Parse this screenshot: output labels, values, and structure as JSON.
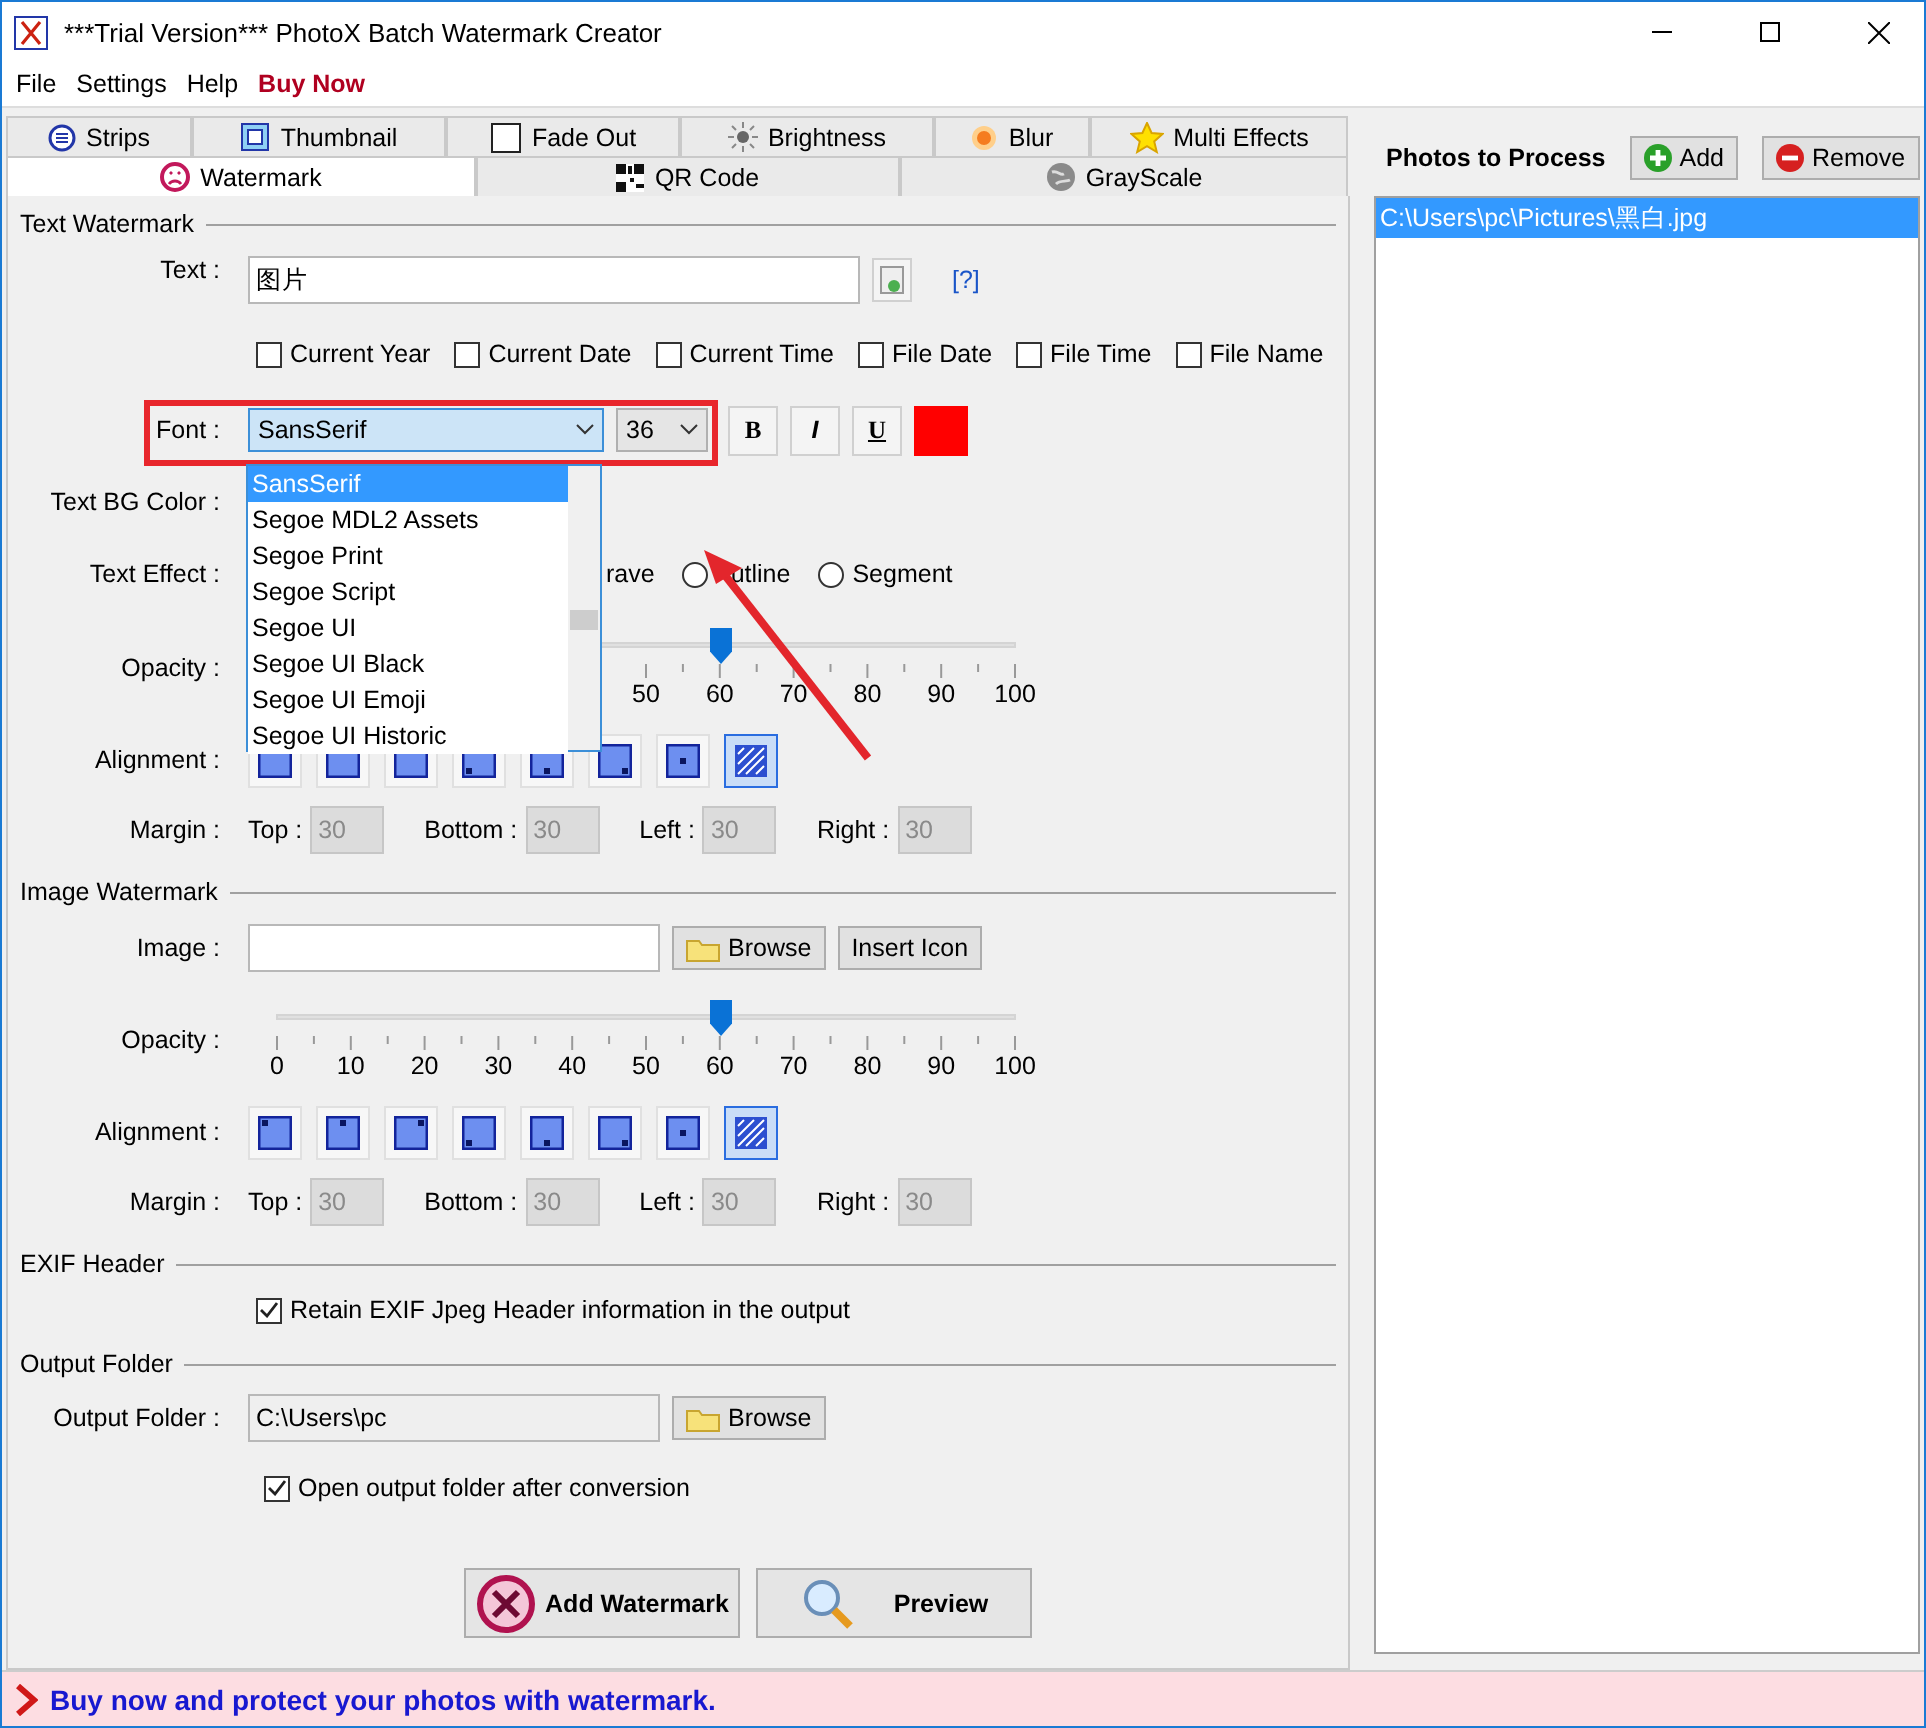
{
  "window": {
    "title": "***Trial Version*** PhotoX Batch Watermark Creator"
  },
  "menu": [
    {
      "label": "File",
      "kind": "plain"
    },
    {
      "label": "Settings",
      "kind": "plain"
    },
    {
      "label": "Help",
      "kind": "plain"
    },
    {
      "label": "Buy Now",
      "kind": "promo"
    }
  ],
  "tabs_top": [
    {
      "label": "Strips",
      "selected": false
    },
    {
      "label": "Thumbnail",
      "selected": false
    },
    {
      "label": "Fade Out",
      "selected": false
    },
    {
      "label": "Brightness",
      "selected": false
    },
    {
      "label": "Blur",
      "selected": false
    },
    {
      "label": "Multi Effects",
      "selected": false
    }
  ],
  "tabs_bottom": [
    {
      "label": "Watermark",
      "selected": true
    },
    {
      "label": "QR Code",
      "selected": false
    },
    {
      "label": "GrayScale",
      "selected": false
    }
  ],
  "text_watermark": {
    "heading": "Text Watermark",
    "text_label": "Text :",
    "text_value": "图片",
    "help": "[?]",
    "tokens": [
      {
        "label": "Current Year",
        "checked": false
      },
      {
        "label": "Current Date",
        "checked": false
      },
      {
        "label": "Current Time",
        "checked": false
      },
      {
        "label": "File Date",
        "checked": false
      },
      {
        "label": "File Time",
        "checked": false
      },
      {
        "label": "File Name",
        "checked": false
      }
    ],
    "font_label": "Font :",
    "font": "SansSerif",
    "size": "36",
    "bold": "B",
    "italic": "I",
    "underline": "U",
    "color": "#ff0000",
    "bg_label": "Text BG Color :",
    "effect_label": "Text Effect  :",
    "effects": [
      {
        "label": "rave",
        "kind": "cut",
        "selected": false
      },
      {
        "label": "utline",
        "kind": "radio",
        "selected": false
      },
      {
        "label": "Segment",
        "kind": "radio",
        "selected": false
      }
    ],
    "opacity_label": "Opacity :",
    "opacity": {
      "level": 0.6,
      "ticks": [
        "50",
        "60",
        "70",
        "80",
        "90",
        "100"
      ]
    },
    "alignment_label": "Alignment :",
    "alignment": [
      {
        "selected": false
      },
      {
        "selected": false
      },
      {
        "selected": false
      },
      {
        "selected": false
      },
      {
        "selected": false
      },
      {
        "selected": false
      },
      {
        "selected": false
      },
      {
        "selected": true
      }
    ],
    "margin_label": "Margin :",
    "margins": [
      {
        "label": "Top :",
        "value": "30",
        "disabled": true
      },
      {
        "label": "Bottom :",
        "value": "30",
        "disabled": true
      },
      {
        "label": "Left :",
        "value": "30",
        "disabled": true
      },
      {
        "label": "Right :",
        "value": "30",
        "disabled": true
      }
    ]
  },
  "font_dropdown": [
    {
      "label": "SansSerif",
      "selected": true
    },
    {
      "label": "Segoe MDL2 Assets",
      "selected": false
    },
    {
      "label": "Segoe Print",
      "selected": false
    },
    {
      "label": "Segoe Script",
      "selected": false
    },
    {
      "label": "Segoe UI",
      "selected": false
    },
    {
      "label": "Segoe UI Black",
      "selected": false
    },
    {
      "label": "Segoe UI Emoji",
      "selected": false
    },
    {
      "label": "Segoe UI Historic",
      "selected": false
    }
  ],
  "image_watermark": {
    "heading": "Image Watermark",
    "image_label": "Image :",
    "browse": "Browse",
    "insert_icon": "Insert Icon",
    "opacity_label": "Opacity :",
    "opacity": {
      "level": 0.6,
      "ticks": [
        "0",
        "10",
        "20",
        "30",
        "40",
        "50",
        "60",
        "70",
        "80",
        "90",
        "100"
      ]
    },
    "alignment_label": "Alignment :",
    "alignment": [
      {
        "selected": false
      },
      {
        "selected": false
      },
      {
        "selected": false
      },
      {
        "selected": false
      },
      {
        "selected": false
      },
      {
        "selected": false
      },
      {
        "selected": false
      },
      {
        "selected": true
      }
    ],
    "margin_label": "Margin :",
    "margins": [
      {
        "label": "Top :",
        "value": "30",
        "disabled": true
      },
      {
        "label": "Bottom :",
        "value": "30",
        "disabled": true
      },
      {
        "label": "Left :",
        "value": "30",
        "disabled": true
      },
      {
        "label": "Right :",
        "value": "30",
        "disabled": true
      }
    ]
  },
  "exif": {
    "heading": "EXIF Header",
    "retain": {
      "label": "Retain EXIF Jpeg Header information in the output",
      "checked": true
    }
  },
  "output": {
    "heading": "Output Folder",
    "label": "Output Folder :",
    "value": "C:\\Users\\pc",
    "browse": "Browse",
    "open_after": {
      "label": "Open output folder after conversion",
      "checked": true
    }
  },
  "actions": [
    {
      "label": "Add Watermark",
      "kind": "add"
    },
    {
      "label": "Preview",
      "kind": "preview"
    }
  ],
  "photos": {
    "title": "Photos to Process",
    "add": "Add",
    "remove": "Remove",
    "items": [
      {
        "path": "C:\\Users\\pc\\Pictures\\黑白.jpg",
        "selected": true
      }
    ]
  },
  "status_bar": {
    "message": "Buy now and protect your photos with watermark."
  }
}
